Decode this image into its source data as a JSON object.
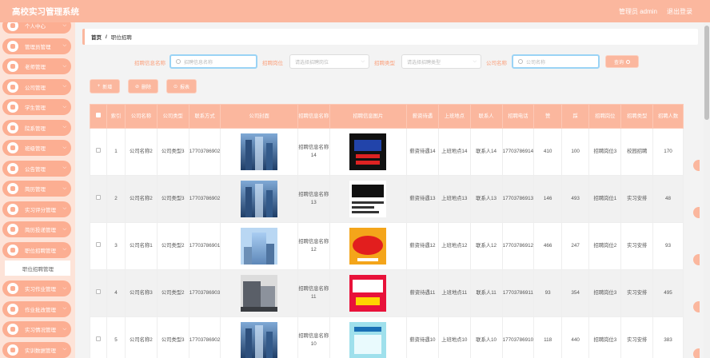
{
  "header": {
    "title": "高校实习管理系统",
    "user": "管理员 admin",
    "logout": "退出登录"
  },
  "sidebar": {
    "items": [
      "个人中心",
      "管理员管理",
      "老师管理",
      "公司管理",
      "学生管理",
      "院系管理",
      "班级管理",
      "公告管理",
      "简历管理",
      "实习评分管理",
      "简历投递管理",
      "职位招聘管理"
    ],
    "sub_item": "职位招聘管理",
    "items_after": [
      "实习作业管理",
      "作业批改管理",
      "实习情况管理",
      "实训数据管理"
    ]
  },
  "breadcrumb": {
    "home": "首页",
    "sep": "/",
    "current": "职位招聘"
  },
  "filters": {
    "name_label": "招聘信息名称",
    "name_placeholder": "招聘信息名称",
    "position_label": "招聘岗位",
    "position_placeholder": "请选择招聘岗位",
    "type_label": "招聘类型",
    "type_placeholder": "请选择招聘类型",
    "company_label": "公司名称",
    "company_placeholder": "公司名称",
    "query": "查询"
  },
  "actions": {
    "add": "新增",
    "delete": "删除",
    "report": "报表"
  },
  "icons": {
    "add": "plus-icon",
    "delete": "trash-icon",
    "report": "chart-icon",
    "query": "search-icon"
  },
  "colors": {
    "accent": "#fbb79e",
    "sidebar_bg": "#fde3d8",
    "input_border": "#9ad3f5"
  },
  "table": {
    "headers": [
      "",
      "索引",
      "公司名称",
      "公司类型",
      "联系方式",
      "公司封面",
      "招聘信息名称",
      "招聘信息图片",
      "薪资待遇",
      "上班地点",
      "联系人",
      "招聘电话",
      "赞",
      "踩",
      "招聘岗位",
      "招聘类型",
      "招聘人数"
    ],
    "rows": [
      {
        "index": "1",
        "company": "公司名称2",
        "ctype": "公司类型3",
        "phone": "17703786902",
        "info": "招聘信息名称14",
        "salary": "薪资待遇14",
        "place": "上班地点14",
        "contact": "联系人14",
        "tel": "17703786914",
        "like": "410",
        "dislike": "100",
        "position": "招聘岗位3",
        "rtype": "校园招聘",
        "count": "170"
      },
      {
        "index": "2",
        "company": "公司名称2",
        "ctype": "公司类型3",
        "phone": "17703786902",
        "info": "招聘信息名称13",
        "salary": "薪资待遇13",
        "place": "上班地点13",
        "contact": "联系人13",
        "tel": "17703786913",
        "like": "146",
        "dislike": "493",
        "position": "招聘岗位1",
        "rtype": "实习安排",
        "count": "48"
      },
      {
        "index": "3",
        "company": "公司名称1",
        "ctype": "公司类型2",
        "phone": "17703786901",
        "info": "招聘信息名称12",
        "salary": "薪资待遇12",
        "place": "上班地点12",
        "contact": "联系人12",
        "tel": "17703786912",
        "like": "466",
        "dislike": "247",
        "position": "招聘岗位2",
        "rtype": "实习安排",
        "count": "93"
      },
      {
        "index": "4",
        "company": "公司名称3",
        "ctype": "公司类型2",
        "phone": "17703786903",
        "info": "招聘信息名称11",
        "salary": "薪资待遇11",
        "place": "上班地点11",
        "contact": "联系人11",
        "tel": "17703786911",
        "like": "93",
        "dislike": "354",
        "position": "招聘岗位3",
        "rtype": "实习安排",
        "count": "495"
      },
      {
        "index": "5",
        "company": "公司名称2",
        "ctype": "公司类型3",
        "phone": "17703786902",
        "info": "招聘信息名称10",
        "salary": "薪资待遇10",
        "place": "上班地点10",
        "contact": "联系人10",
        "tel": "17703786910",
        "like": "118",
        "dislike": "440",
        "position": "招聘岗位3",
        "rtype": "实习安排",
        "count": "383"
      }
    ]
  }
}
